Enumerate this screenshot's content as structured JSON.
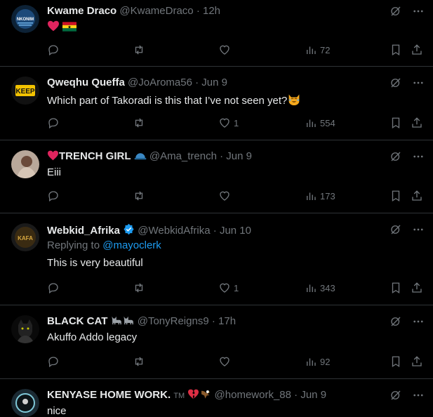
{
  "tweets": [
    {
      "name": "Kwame Draco",
      "handle": "@KwameDraco",
      "sep": "·",
      "time": "12h",
      "text": "",
      "emoji": [
        "red-heart",
        "ghana-flag"
      ],
      "replying_label": "",
      "replying_to": "",
      "likes": "",
      "views": "72"
    },
    {
      "name": "Qweqhu Queffa",
      "handle": "@JoAroma56",
      "sep": "·",
      "time": "Jun 9",
      "text": "Which part of Takoradi is this that I’ve not seen yet?",
      "emoji": [
        "laughing-cat"
      ],
      "replying_label": "",
      "replying_to": "",
      "likes": "1",
      "views": "554"
    },
    {
      "name": "TRENCH GIRL",
      "handle": "@Ama_trench",
      "sep": "·",
      "time": "Jun 9",
      "text": "Eiii",
      "emoji": [
        "red-heart",
        "blue-cap"
      ],
      "replying_label": "",
      "replying_to": "",
      "likes": "",
      "views": "173"
    },
    {
      "name": "Webkid_Afrika",
      "handle": "@WebkidAfrika",
      "sep": "·",
      "time": "Jun 10",
      "text": "This is very beautiful",
      "emoji": [
        "verified-badge"
      ],
      "replying_label": "Replying to",
      "replying_to": "@mayoclerk",
      "likes": "1",
      "views": "343"
    },
    {
      "name": "BLACK CAT",
      "handle": "@TonyReigns9",
      "sep": "·",
      "time": "17h",
      "text": "Akuffo Addo legacy",
      "emoji": [
        "black-cat",
        "black-cat"
      ],
      "replying_label": "",
      "replying_to": "",
      "likes": "",
      "views": "92"
    },
    {
      "name": "KENYASE HOME WORK.",
      "handle": "@homework_88",
      "sep": "·",
      "time": "Jun 9",
      "text": "nice",
      "emoji": [
        "tm",
        "broken-heart",
        "eagle"
      ],
      "tm": "TM",
      "replying_label": "",
      "replying_to": "",
      "likes": "",
      "views": ""
    }
  ],
  "colors": {
    "background": "#000000",
    "text": "#e7e9ea",
    "muted": "#71767b",
    "link": "#1d9bf0",
    "divider": "#2f3336"
  },
  "icons": [
    "reply-icon",
    "retweet-icon",
    "like-icon",
    "views-icon",
    "bookmark-icon",
    "share-icon",
    "grok-icon",
    "more-icon"
  ]
}
